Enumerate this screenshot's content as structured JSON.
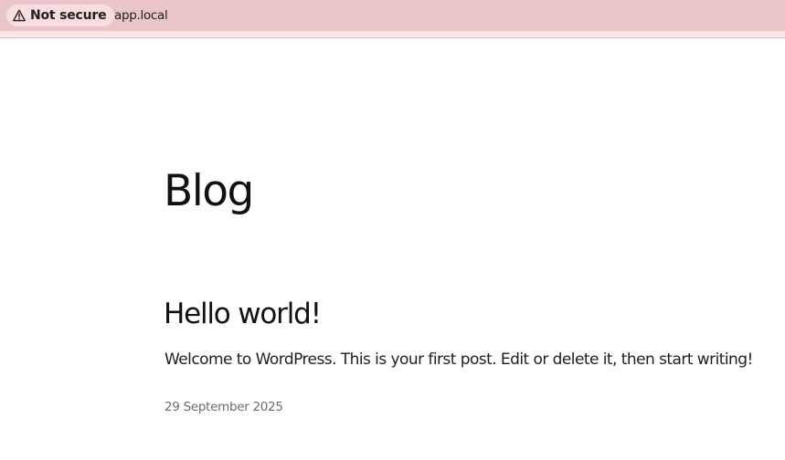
{
  "browser": {
    "security_label": "Not secure",
    "security_icon": "warning-triangle-icon",
    "url": "app.local",
    "bar_color": "#e9c4c9"
  },
  "page": {
    "title": "Blog"
  },
  "post": {
    "title": "Hello world!",
    "excerpt": "Welcome to WordPress. This is your first post. Edit or delete it, then start writing!",
    "date": "29 September 2025"
  }
}
